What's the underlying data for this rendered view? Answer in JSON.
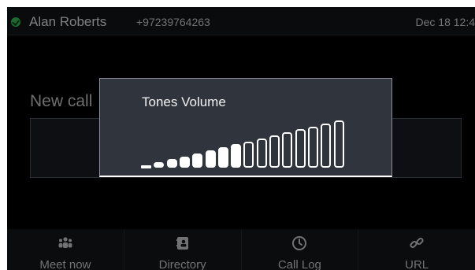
{
  "status_bar": {
    "user_name": "Alan Roberts",
    "user_number": "+97239764263",
    "date_time": "Dec 18 12:4",
    "presence": "available"
  },
  "new_call": {
    "title": "New call"
  },
  "softkeys": [
    {
      "label": "Meet now",
      "icon": "people-icon"
    },
    {
      "label": "Directory",
      "icon": "directory-icon"
    },
    {
      "label": "Call Log",
      "icon": "clock-icon"
    },
    {
      "label": "URL",
      "icon": "link-icon"
    }
  ],
  "volume_popup": {
    "title": "Tones Volume",
    "level": 8,
    "max_level": 16
  },
  "colors": {
    "presence_green": "#35c159",
    "popup_bg": "#2f343d",
    "bar_white": "#ffffff"
  }
}
